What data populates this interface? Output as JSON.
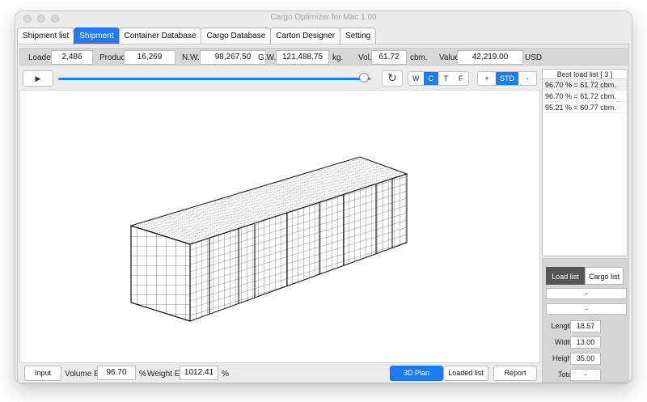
{
  "window": {
    "title": "Cargo Optimizer for Mac 1.00"
  },
  "tabs": [
    "Shipment list",
    "Shipment",
    "Container Database",
    "Cargo Database",
    "Carton Designer",
    "Setting"
  ],
  "active_tab": 1,
  "info": {
    "loaded_label": "Loaded",
    "loaded": "2,486",
    "product_label": "Product",
    "product": "16,269",
    "nw_label": "N.W.",
    "nw": "98,267.50",
    "gw_label": "G.W.",
    "gw": "121,488.75",
    "kg_unit": "kg.",
    "vol_label": "Vol.",
    "vol": "61.72",
    "cbm_unit": "cbm.",
    "value_label": "Value",
    "value": "42,219.00",
    "usd_unit": "USD"
  },
  "toolbar": {
    "slider_fraction": 0.98,
    "view_buttons": [
      "W",
      "C",
      "T",
      "F"
    ],
    "view_active": "C",
    "zoom_buttons": [
      "+",
      "STD",
      "-"
    ],
    "zoom_active": "STD"
  },
  "best_list": {
    "title": "Best load list [ 3 ]",
    "items": [
      "96.70 % = 61.72 cbm.",
      "96.70 % = 61.72 cbm.",
      "95.21 % = 60.77 cbm."
    ]
  },
  "right_panel": {
    "tab_load": "Load list",
    "tab_cargo": "Cargo list",
    "field1": "-",
    "field2": "-",
    "length_label": "Length",
    "length": "18.57",
    "width_label": "Width",
    "width": "13.00",
    "height_label": "Height",
    "height": "35.00",
    "total_label": "Total",
    "total": "-"
  },
  "footer": {
    "input_btn": "Input",
    "vol_eff_label": "Volume Eff.",
    "vol_eff": "96.70",
    "percent1": "%",
    "weight_eff_label": "Weight Eff.",
    "weight_eff": "1012.41",
    "percent2": "%",
    "plan_btn": "3D Plan",
    "loaded_btn": "Loaded list",
    "report_btn": "Report"
  },
  "colors": {
    "accent": "#1e7cf2"
  },
  "icons": {
    "play": "play-icon",
    "refresh": "refresh-icon"
  }
}
